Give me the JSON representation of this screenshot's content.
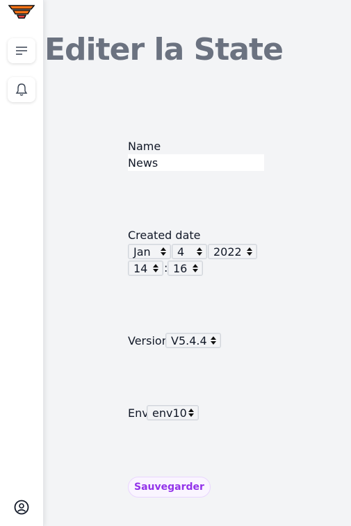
{
  "page": {
    "title": "Editer la State"
  },
  "form": {
    "name_label": "Name",
    "name_value": "News",
    "created_label": "Created date",
    "date": {
      "month": "Jan",
      "day": "4",
      "year": "2022",
      "hour": "14",
      "separator": ":",
      "minute": "16"
    },
    "version_label": "Version",
    "version_value": "V5.4.4",
    "env_label": "Env",
    "env_value": "env10",
    "save_label": "Sauvegarder"
  },
  "colors": {
    "accent": "#9333ea",
    "logo_orange": "#f97316",
    "title_gray": "#6b7280"
  },
  "icons": [
    "logo-icon",
    "menu-icon",
    "bell-icon",
    "user-circle-icon",
    "select-arrows-icon"
  ]
}
